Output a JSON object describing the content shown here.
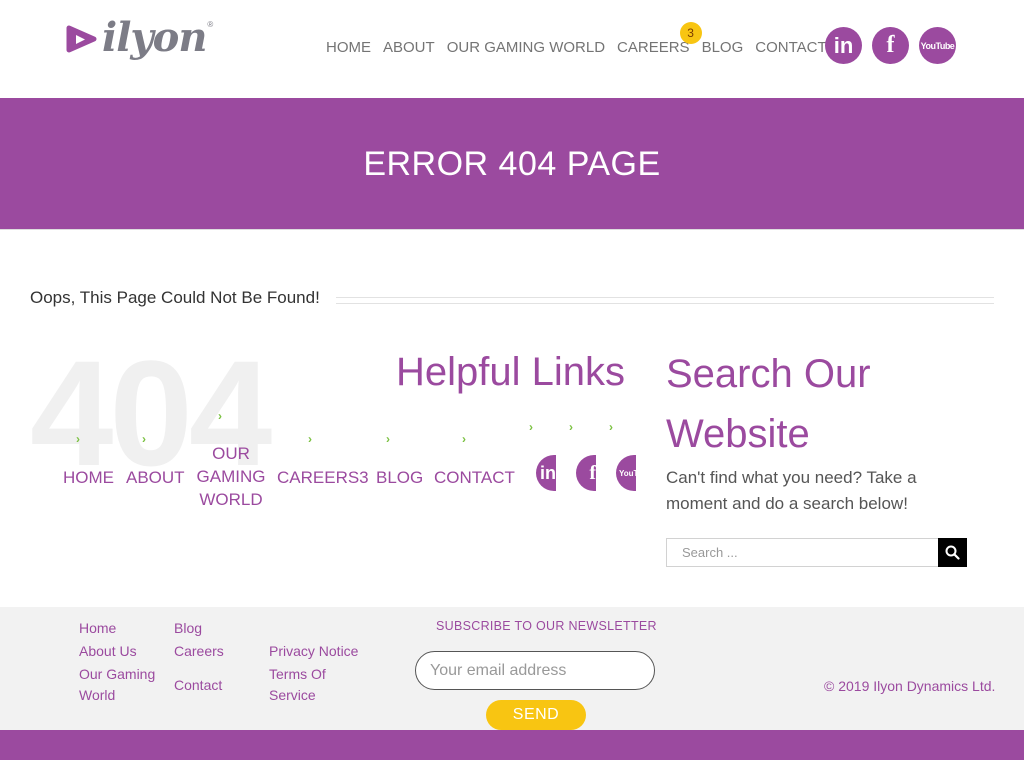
{
  "header": {
    "logo_text": "ilyon",
    "logo_reg": "®",
    "nav": [
      {
        "label": "HOME"
      },
      {
        "label": "ABOUT"
      },
      {
        "label": "OUR GAMING WORLD"
      },
      {
        "label": "CAREERS",
        "badge": "3"
      },
      {
        "label": "BLOG"
      },
      {
        "label": "CONTACT"
      }
    ],
    "social": [
      {
        "icon": "linkedin-icon",
        "glyph": "in"
      },
      {
        "icon": "facebook-icon",
        "glyph": "f"
      },
      {
        "icon": "youtube-icon",
        "glyph": "YouTube"
      }
    ]
  },
  "title_band": {
    "title": "ERROR 404 PAGE"
  },
  "main": {
    "oops": "Oops, This Page Could Not Be Found!",
    "big_number": "404",
    "helpful": {
      "title": "Helpful Links",
      "links": [
        {
          "label": "HOME"
        },
        {
          "label": "ABOUT"
        },
        {
          "label": "OUR GAMING WORLD"
        },
        {
          "label": "CAREERS3"
        },
        {
          "label": "BLOG"
        },
        {
          "label": "CONTACT"
        }
      ],
      "arrow": "›"
    },
    "search": {
      "title": "Search Our Website",
      "description": "Can't find what you need? Take a moment and do a search below!",
      "placeholder": "Search ..."
    }
  },
  "footer": {
    "col1": [
      "Home",
      "About Us",
      "Our Gaming World"
    ],
    "col2": [
      "Blog",
      "Careers",
      "Contact"
    ],
    "col3": [
      "Privacy Notice",
      "Terms Of Service"
    ],
    "newsletter_title": "SUBSCRIBE TO OUR NEWSLETTER",
    "email_placeholder": "Your email address",
    "send_label": "SEND",
    "copyright": "© 2019 Ilyon Dynamics Ltd."
  },
  "colors": {
    "brand": "#9b4a9f",
    "accent": "#f8c512",
    "arrow": "#7bc142"
  }
}
